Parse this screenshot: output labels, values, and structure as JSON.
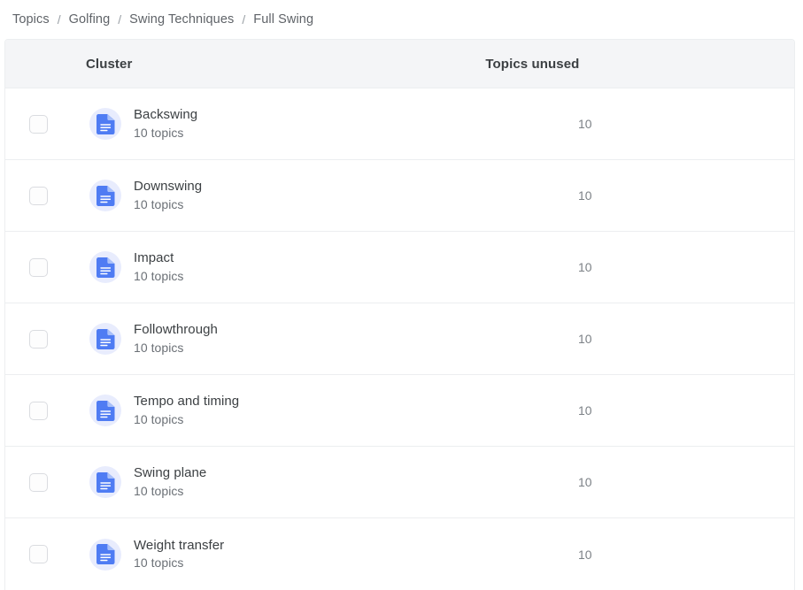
{
  "breadcrumb": {
    "separator": "/",
    "items": [
      {
        "label": "Topics"
      },
      {
        "label": "Golfing"
      },
      {
        "label": "Swing Techniques"
      },
      {
        "label": "Full Swing"
      }
    ]
  },
  "table": {
    "columns": {
      "select": "",
      "cluster": "Cluster",
      "topics_unused": "Topics unused"
    },
    "row_icon": "document-icon",
    "rows": [
      {
        "name": "Backswing",
        "subtitle": "10 topics",
        "topics_unused": "10",
        "selected": false
      },
      {
        "name": "Downswing",
        "subtitle": "10 topics",
        "topics_unused": "10",
        "selected": false
      },
      {
        "name": "Impact",
        "subtitle": "10 topics",
        "topics_unused": "10",
        "selected": false
      },
      {
        "name": "Followthrough",
        "subtitle": "10 topics",
        "topics_unused": "10",
        "selected": false
      },
      {
        "name": "Tempo and timing",
        "subtitle": "10 topics",
        "topics_unused": "10",
        "selected": false
      },
      {
        "name": "Swing plane",
        "subtitle": "10 topics",
        "topics_unused": "10",
        "selected": false
      },
      {
        "name": "Weight transfer",
        "subtitle": "10 topics",
        "topics_unused": "10",
        "selected": false
      }
    ]
  },
  "colors": {
    "icon_blue": "#4f7cf3",
    "icon_badge_bg": "#e8ecfd",
    "header_bg": "#f4f5f7",
    "border": "#eceef0",
    "text_primary": "#3c4043",
    "text_secondary": "#6b7076",
    "text_muted": "#7d8287"
  }
}
